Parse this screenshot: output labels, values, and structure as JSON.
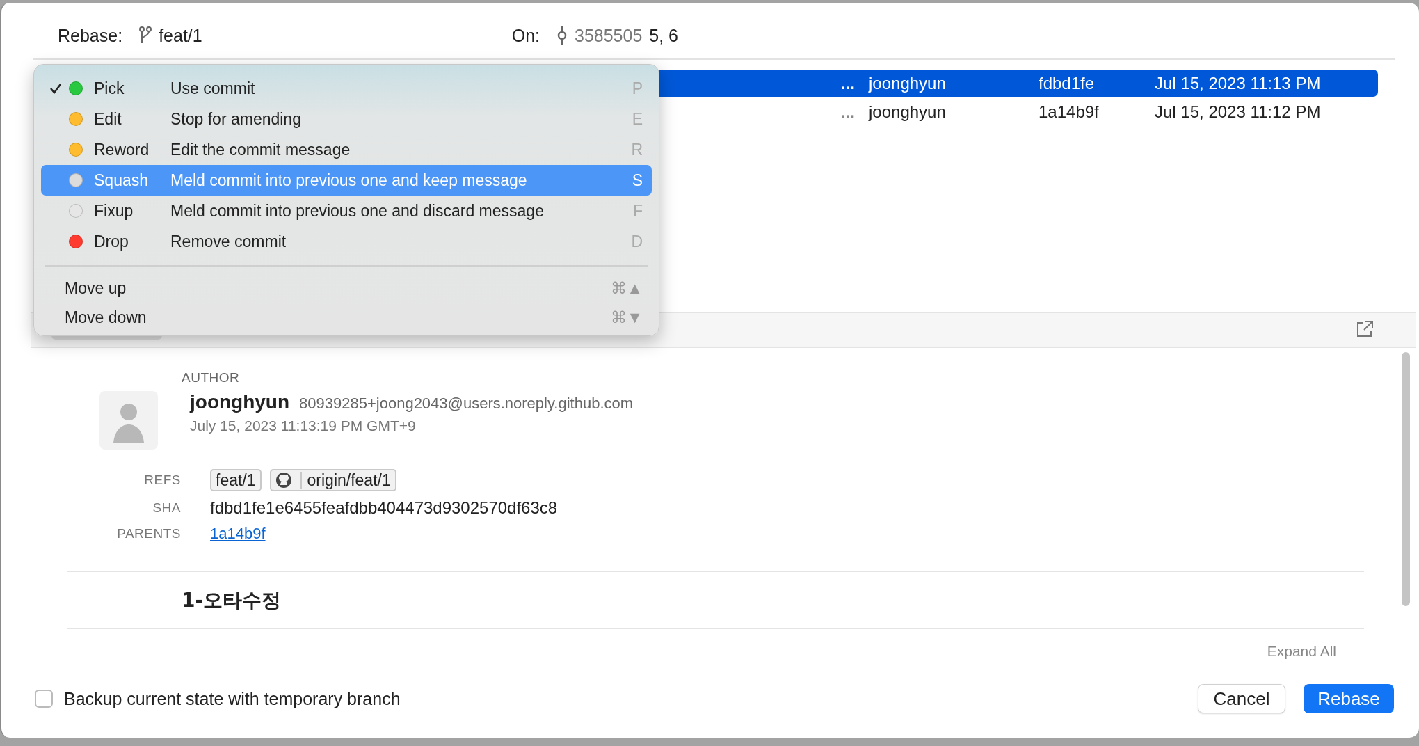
{
  "header": {
    "rebase_label": "Rebase:",
    "branch": "feat/1",
    "on_label": "On:",
    "commit": "3585505",
    "commit_extra": "5, 6"
  },
  "commits": [
    {
      "dots": "...",
      "author": "joonghyun",
      "sha": "fdbd1fe",
      "date": "Jul 15, 2023 11:13 PM",
      "selected": true
    },
    {
      "dots": "...",
      "author": "joonghyun",
      "sha": "1a14b9f",
      "date": "Jul 15, 2023 11:12 PM",
      "selected": false
    }
  ],
  "action_menu": {
    "actions": [
      {
        "name": "Pick",
        "description": "Use commit",
        "key": "P",
        "checked": true,
        "selected": false,
        "color": "#28c840"
      },
      {
        "name": "Edit",
        "description": "Stop for amending",
        "key": "E",
        "checked": false,
        "selected": false,
        "color": "#febc2e"
      },
      {
        "name": "Reword",
        "description": "Edit the commit message",
        "key": "R",
        "checked": false,
        "selected": false,
        "color": "#febc2e"
      },
      {
        "name": "Squash",
        "description": "Meld commit into previous one and keep message",
        "key": "S",
        "checked": false,
        "selected": true,
        "color": "#dcdcdc"
      },
      {
        "name": "Fixup",
        "description": "Meld commit into previous one and discard message",
        "key": "F",
        "checked": false,
        "selected": false,
        "color": "#e6e6e6"
      },
      {
        "name": "Drop",
        "description": "Remove commit",
        "key": "D",
        "checked": false,
        "selected": false,
        "color": "#ff3b30"
      }
    ],
    "moves": [
      {
        "label": "Move up",
        "shortcut": "⌘▲"
      },
      {
        "label": "Move down",
        "shortcut": "⌘▼"
      }
    ]
  },
  "detail": {
    "author_heading": "AUTHOR",
    "author": {
      "name": "joonghyun",
      "email": "80939285+joong2043@users.noreply.github.com",
      "date": "July 15, 2023 11:13:19 PM GMT+9"
    },
    "refs_label": "REFS",
    "refs": [
      {
        "name": "feat/1",
        "kind": "local"
      },
      {
        "name": "origin/feat/1",
        "kind": "remote"
      }
    ],
    "sha_label": "SHA",
    "sha": "fdbd1fe1e6455feafdbb404473d9302570df63c8",
    "parents_label": "PARENTS",
    "parents": [
      "1a14b9f"
    ],
    "message": "1-오타수정",
    "expand_all": "Expand All"
  },
  "footer": {
    "backup": {
      "label": "Backup current state with temporary branch",
      "checked": false
    },
    "buttons": [
      {
        "label": "Cancel",
        "kind": "secondary"
      },
      {
        "label": "Rebase",
        "kind": "primary"
      }
    ]
  }
}
